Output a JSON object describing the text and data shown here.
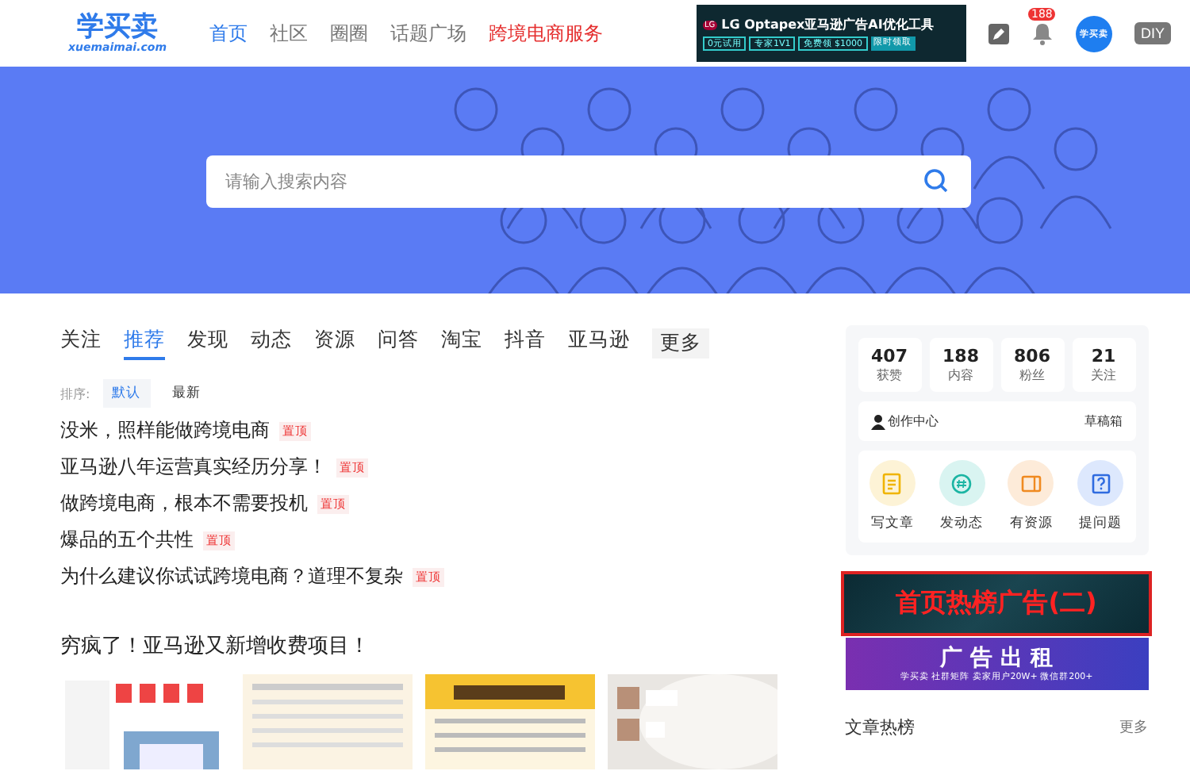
{
  "header": {
    "logo": "学买卖",
    "logo_sub": "xuemaimai.com",
    "nav": [
      {
        "label": "首页",
        "selected": true,
        "kind": "normal"
      },
      {
        "label": "社区",
        "selected": false,
        "kind": "normal"
      },
      {
        "label": "圈圈",
        "selected": false,
        "kind": "normal"
      },
      {
        "label": "话题广场",
        "selected": false,
        "kind": "normal"
      },
      {
        "label": "跨境电商服务",
        "selected": false,
        "kind": "highlight"
      }
    ],
    "ad": {
      "brand": "LG",
      "title": "LG Optapex亚马逊广告AI优化工具",
      "tags": [
        "0元试用",
        "专家1V1",
        "免费领 $1000"
      ],
      "cta": "限时领取"
    },
    "notification_count": "188",
    "avatar": "学买卖",
    "diy": "DIY"
  },
  "search": {
    "placeholder": "请输入搜索内容"
  },
  "tabs": [
    {
      "label": "关注",
      "selected": false
    },
    {
      "label": "推荐",
      "selected": true
    },
    {
      "label": "发现",
      "selected": false
    },
    {
      "label": "动态",
      "selected": false
    },
    {
      "label": "资源",
      "selected": false
    },
    {
      "label": "问答",
      "selected": false
    },
    {
      "label": "淘宝",
      "selected": false
    },
    {
      "label": "抖音",
      "selected": false
    },
    {
      "label": "亚马逊",
      "selected": false
    }
  ],
  "more_tab": "更多",
  "sort": {
    "label": "排序:",
    "options": [
      {
        "label": "默认",
        "selected": true
      },
      {
        "label": "最新",
        "selected": false
      }
    ]
  },
  "pinned_articles": [
    {
      "title": "没米，照样能做跨境电商",
      "badge": "置顶"
    },
    {
      "title": "亚马逊八年运营真实经历分享！",
      "badge": "置顶"
    },
    {
      "title": "做跨境电商，根本不需要投机",
      "badge": "置顶"
    },
    {
      "title": "爆品的五个共性",
      "badge": "置顶"
    },
    {
      "title": "为什么建议你试试跨境电商？道理不复杂",
      "badge": "置顶"
    }
  ],
  "feed_post": {
    "title": "穷疯了！亚马逊又新增收费项目！"
  },
  "profile": {
    "stats": [
      {
        "value": "407",
        "label": "获赞"
      },
      {
        "value": "188",
        "label": "内容"
      },
      {
        "value": "806",
        "label": "粉丝"
      },
      {
        "value": "21",
        "label": "关注"
      }
    ],
    "creator_center": "创作中心",
    "drafts": "草稿箱",
    "actions": [
      {
        "label": "写文章",
        "kind": "article",
        "color": "#fdf3d6"
      },
      {
        "label": "发动态",
        "kind": "post",
        "color": "#d9f4f1"
      },
      {
        "label": "有资源",
        "kind": "resource",
        "color": "#fdebd9"
      },
      {
        "label": "提问题",
        "kind": "question",
        "color": "#dde8fd"
      }
    ]
  },
  "banners": [
    {
      "kind": "hot",
      "text": "首页热榜广告(二)"
    },
    {
      "kind": "rent",
      "text": "广 告 出 租",
      "sub": "学买卖 社群矩阵 卖家用户20W+ 微信群200+"
    }
  ],
  "hot_articles": {
    "title": "文章热榜",
    "more": "更多"
  }
}
